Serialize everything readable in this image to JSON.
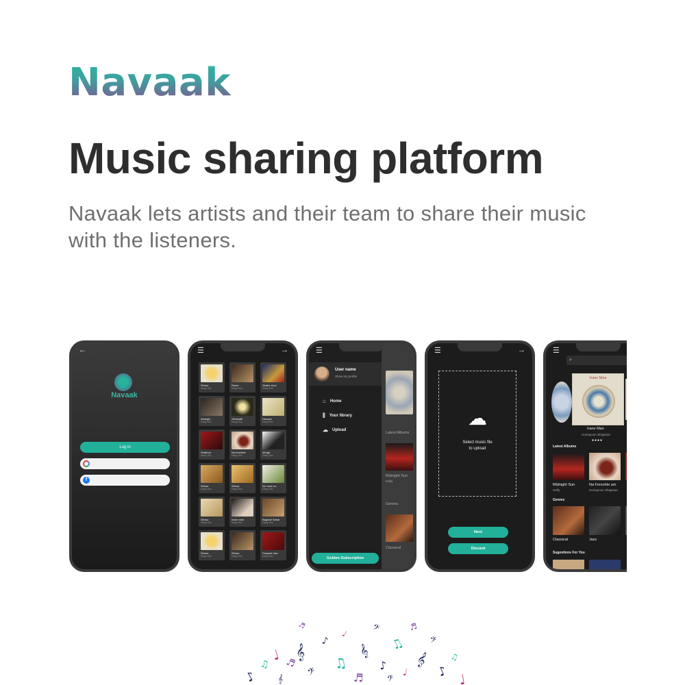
{
  "brand": "Navaak",
  "headline": "Music sharing platform",
  "description": "Navaak lets artists and their team to share their music with the listeners.",
  "colors": {
    "accent": "#22b09a",
    "brand_purple": "#8a4f8c",
    "heading": "#2e2e2e",
    "body_text": "#6f6f6f"
  },
  "phone1": {
    "back_icon": "arrow-left-icon",
    "logo_text": "Navaak",
    "login_label": "Log in",
    "google_icon": "google-icon",
    "facebook_icon": "facebook-icon"
  },
  "phone2": {
    "menu_icon": "hamburger-menu-icon",
    "forward_icon": "arrow-right-icon",
    "tiles": [
      {
        "title": "Shiraz",
        "sub": "Dang Sho"
      },
      {
        "title": "Raver",
        "sub": "Dang Sho"
      },
      {
        "title": "Shabe sizzi",
        "sub": "Dang Sho"
      },
      {
        "title": "Ashegin",
        "sub": "Dang Sho"
      },
      {
        "title": "Ghiabath",
        "sub": "Dang Sho"
      },
      {
        "title": "Havape",
        "sub": "Dang Sho"
      },
      {
        "title": "Shabnar",
        "sub": "Dang Sho"
      },
      {
        "title": "Na fereshte",
        "sub": "Dang Sho"
      },
      {
        "title": "Morgh",
        "sub": "Dang Sho"
      },
      {
        "title": "Shiraz",
        "sub": "Dang Sho"
      },
      {
        "title": "Shiraz",
        "sub": "Dang Sho"
      },
      {
        "title": "No naze no",
        "sub": "Dang Sho"
      },
      {
        "title": "Shiraz",
        "sub": "Dang Sho"
      },
      {
        "title": "Irane man",
        "sub": "Dang Sho"
      },
      {
        "title": "Baghde Sahar",
        "sub": "Dang Sho"
      },
      {
        "title": "Shiraz",
        "sub": "Dang Sho"
      },
      {
        "title": "Shiraz",
        "sub": "Dang Sho"
      },
      {
        "title": "Faryade Iran",
        "sub": "Dang Sho"
      }
    ]
  },
  "phone3": {
    "menu_icon": "hamburger-menu-icon",
    "user_name": "User name",
    "user_sub": "Show my profile",
    "menu": [
      {
        "icon": "home-icon",
        "label": "Home"
      },
      {
        "icon": "library-icon",
        "label": "Your library"
      },
      {
        "icon": "upload-cloud-icon",
        "label": "Upload"
      }
    ],
    "peek_latest": "Latest Albums",
    "peek_album_title": "Midnight Sun",
    "peek_album_sub": "Gelfy",
    "peek_genres": "Genres",
    "peek_genre": "Classical",
    "golden_label": "Golden Subscription"
  },
  "phone4": {
    "menu_icon": "hamburger-menu-icon",
    "forward_icon": "arrow-right-icon",
    "upload_icon": "cloud-upload-icon",
    "upload_line1": "Select music file",
    "upload_line2": "to upload",
    "next_label": "Next",
    "discard_label": "Discard"
  },
  "phone5": {
    "menu_icon": "hamburger-menu-icon",
    "search_icon": "search-icon",
    "featured_title": "Irane Man",
    "featured_sub": "Homayoun Shajarian",
    "latest_albums": "Latest Albums",
    "albums": [
      {
        "title": "Midnight Sun",
        "sub": "Gelfy"
      },
      {
        "title": "Na Fereshte am",
        "sub": "Homayoun Shajarian"
      }
    ],
    "genres": "Genres",
    "genre_items": [
      "Classical",
      "Jazz"
    ],
    "suggestions": "Sugestions For You",
    "cover_text": "Irane Man"
  }
}
